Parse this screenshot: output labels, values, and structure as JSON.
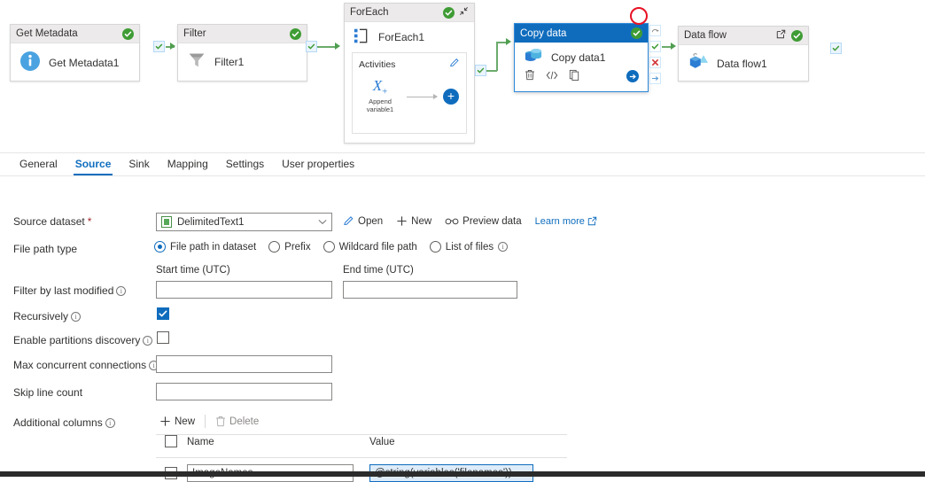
{
  "canvas": {
    "nodes": [
      {
        "id": "get-metadata",
        "header": "Get Metadata",
        "name": "Get Metadata1",
        "icon": "info-icon",
        "status": "valid"
      },
      {
        "id": "filter",
        "header": "Filter",
        "name": "Filter1",
        "icon": "funnel-icon",
        "status": "valid"
      },
      {
        "id": "foreach",
        "header": "ForEach",
        "name": "ForEach1",
        "icon": "foreach-icon",
        "status": "valid"
      },
      {
        "id": "copy-data",
        "header": "Copy data",
        "name": "Copy data1",
        "icon": "copy-data-icon",
        "status": "valid"
      },
      {
        "id": "data-flow",
        "header": "Data flow",
        "name": "Data flow1",
        "icon": "data-flow-icon",
        "status": "valid"
      }
    ],
    "foreach": {
      "activities_label": "Activities",
      "inner_activity": "Append variable1",
      "inner_activity_icon": "x-variable-icon",
      "edit_icon": "pencil-icon",
      "add_icon": "plus-circle-icon",
      "collapse_icon": "collapse-icon"
    },
    "copy_data_toolbar": {
      "delete_icon": "trash-icon",
      "code_icon": "code-icon",
      "clone_icon": "clone-icon",
      "run_icon": "run-arrow-icon"
    },
    "connector_handles": {
      "skip": "skip-handle-icon",
      "success": "success-handle-icon",
      "failure": "failure-handle-icon",
      "completion": "completion-handle-icon"
    },
    "data_flow_open_icon": "open-external-icon",
    "annotation": "red-circle-annotation"
  },
  "tabs": [
    {
      "label": "General",
      "active": false
    },
    {
      "label": "Source",
      "active": true
    },
    {
      "label": "Sink",
      "active": false
    },
    {
      "label": "Mapping",
      "active": false
    },
    {
      "label": "Settings",
      "active": false
    },
    {
      "label": "User properties",
      "active": false
    }
  ],
  "form": {
    "source_dataset": {
      "label": "Source dataset",
      "required_marker": "*",
      "value": "DelimitedText1",
      "dataset_icon": "dataset-icon",
      "caret_icon": "chevron-down-icon",
      "open_label": "Open",
      "open_icon": "pencil-icon",
      "new_label": "New",
      "new_icon": "plus-icon",
      "preview_label": "Preview data",
      "preview_icon": "glasses-icon",
      "learn_more_label": "Learn more",
      "learn_more_icon": "open-external-icon"
    },
    "file_path_type": {
      "label": "File path type",
      "options": [
        {
          "label": "File path in dataset",
          "selected": true,
          "info": false
        },
        {
          "label": "Prefix",
          "selected": false,
          "info": false
        },
        {
          "label": "Wildcard file path",
          "selected": false,
          "info": false
        },
        {
          "label": "List of files",
          "selected": false,
          "info": true
        }
      ]
    },
    "filter_last_modified": {
      "label": "Filter by last modified",
      "info": true,
      "start_label": "Start time (UTC)",
      "start_value": "",
      "end_label": "End time (UTC)",
      "end_value": ""
    },
    "recursively": {
      "label": "Recursively",
      "info": true,
      "checked": true
    },
    "enable_partitions_discovery": {
      "label": "Enable partitions discovery",
      "info": true,
      "checked": false
    },
    "max_concurrent_connections": {
      "label": "Max concurrent connections",
      "info": true,
      "value": ""
    },
    "skip_line_count": {
      "label": "Skip line count",
      "info": false,
      "value": ""
    },
    "additional_columns": {
      "label": "Additional columns",
      "info": true,
      "new_label": "New",
      "new_icon": "plus-icon",
      "delete_label": "Delete",
      "delete_icon": "trash-icon",
      "columns": [
        "Name",
        "Value"
      ],
      "rows": [
        {
          "checked": false,
          "name": "ImageNames",
          "value": "@string(variables('filenames'))",
          "value_focused": true
        }
      ]
    }
  },
  "colors": {
    "accent": "#0f6cbd",
    "link": "#106ebe",
    "valid_green": "#3f9c35",
    "edge_green": "#6bab6b",
    "error_red": "#e81123",
    "required_red": "#a4262c",
    "selected_header": "#0f6cbd",
    "node_header": "#eceaea"
  }
}
